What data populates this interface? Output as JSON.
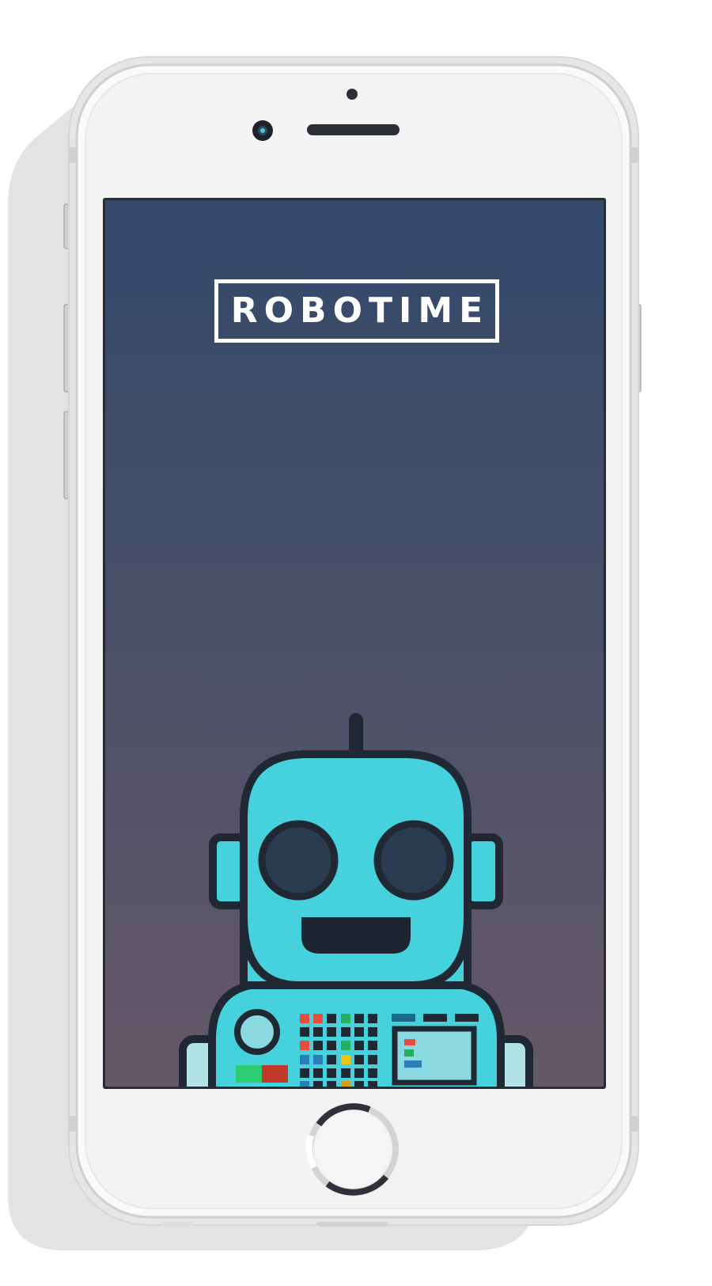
{
  "app": {
    "logo_text": "ROBOTIME"
  },
  "colors": {
    "screen_top": "#33496b",
    "screen_mid": "#4b5069",
    "screen_bottom": "#655867",
    "robot_body": "#45d2dd",
    "robot_outline": "#1f2833",
    "robot_eye": "#2c3c50",
    "robot_mouth": "#1c2530",
    "phone_body": "#f3f3f3",
    "phone_shadow": "#e4e4e4"
  },
  "icons": {
    "mascot": "robot-mascot",
    "front_camera": "camera-icon",
    "earpiece": "speaker-grille",
    "home_button": "home-button-ring",
    "loading": "loading-spinner"
  }
}
